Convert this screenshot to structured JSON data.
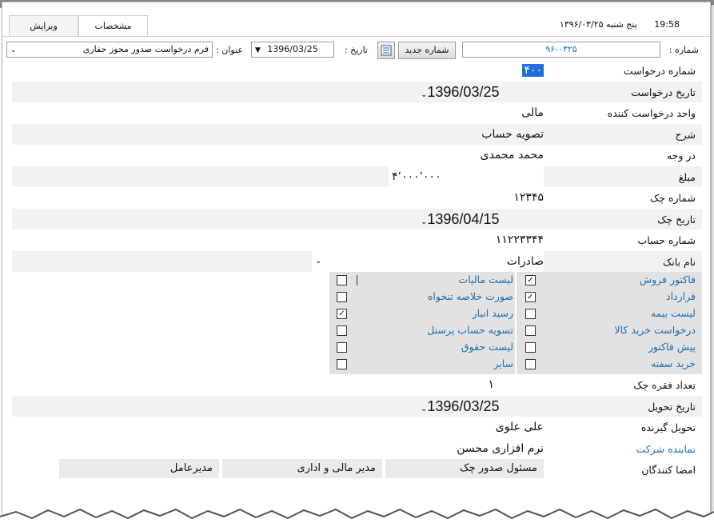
{
  "header": {
    "tabs": [
      "ویرایش",
      "مشخصات"
    ],
    "time": "19:58",
    "day_date": "پنج شنبه ۱۳۹۶/۰۳/۲۵"
  },
  "toolbar": {
    "number_label": "شماره :",
    "number_value": "۹۶-۰۳۲۵",
    "new_number_button": "شماره جدید",
    "date_label": "تاریخ :",
    "date_value": "1396/03/25",
    "title_label": "عنوان :",
    "title_value": "فرم درخواست صدور مجوز حفاری"
  },
  "fields": {
    "request_no": {
      "label": "شماره درخواست",
      "value": "۴۰۰"
    },
    "request_date": {
      "label": "تاریخ درخواست",
      "value": "1396/03/25"
    },
    "request_unit": {
      "label": "واحد درخواست کننده",
      "value": "مالی"
    },
    "description": {
      "label": "شرح",
      "value": "تصویه حساب"
    },
    "payee": {
      "label": "در وجه",
      "value": "محمد محمدی"
    },
    "amount": {
      "label": "مبلغ",
      "value": "۴٬۰۰۰٬۰۰۰"
    },
    "cheque_no": {
      "label": "شماره چک",
      "value": "۱۲۳۴۵"
    },
    "cheque_date": {
      "label": "تاریخ چک",
      "value": "1396/04/15"
    },
    "account_no": {
      "label": "شماره حساب",
      "value": "۱۱۲۲۳۳۴۴"
    },
    "bank_name": {
      "label": "نام بانک",
      "value": "صادرات"
    },
    "cheque_count": {
      "label": "تعداد فقره چک",
      "value": "۱"
    },
    "delivery_date": {
      "label": "تاریخ تحویل",
      "value": "1396/03/25"
    },
    "receiver": {
      "label": "تحویل گیرنده",
      "value": "علی علوی"
    },
    "company_rep": {
      "label": "نماینده شرکت",
      "value": "نرم افزاری محسن"
    }
  },
  "attachments": {
    "right": [
      {
        "label": "فاکتور فروش",
        "checked": true
      },
      {
        "label": "قرارداد",
        "checked": true
      },
      {
        "label": "لیست بیمه",
        "checked": false
      },
      {
        "label": "درخواست خرید کالا",
        "checked": false
      },
      {
        "label": "پیش فاکتور",
        "checked": false
      },
      {
        "label": "خرید سفته",
        "checked": false
      }
    ],
    "left": [
      {
        "label": "لیست مالیات",
        "checked": false
      },
      {
        "label": "صورت خلاصه تنخواه",
        "checked": false
      },
      {
        "label": "رسید انبار",
        "checked": true
      },
      {
        "label": "تسویه حساب پرسنل",
        "checked": false
      },
      {
        "label": "لیست حقوق",
        "checked": false
      },
      {
        "label": "سایر",
        "checked": false
      }
    ]
  },
  "signers": {
    "label": "امضا کنندگان",
    "cells": [
      "مسئول صدور چک",
      "مدیر مالی و اداری",
      "مدیرعامل"
    ]
  },
  "colors": {
    "link": "#1a6fb3",
    "selection": "#1f6fd6",
    "shade": "#f2f2f2"
  }
}
